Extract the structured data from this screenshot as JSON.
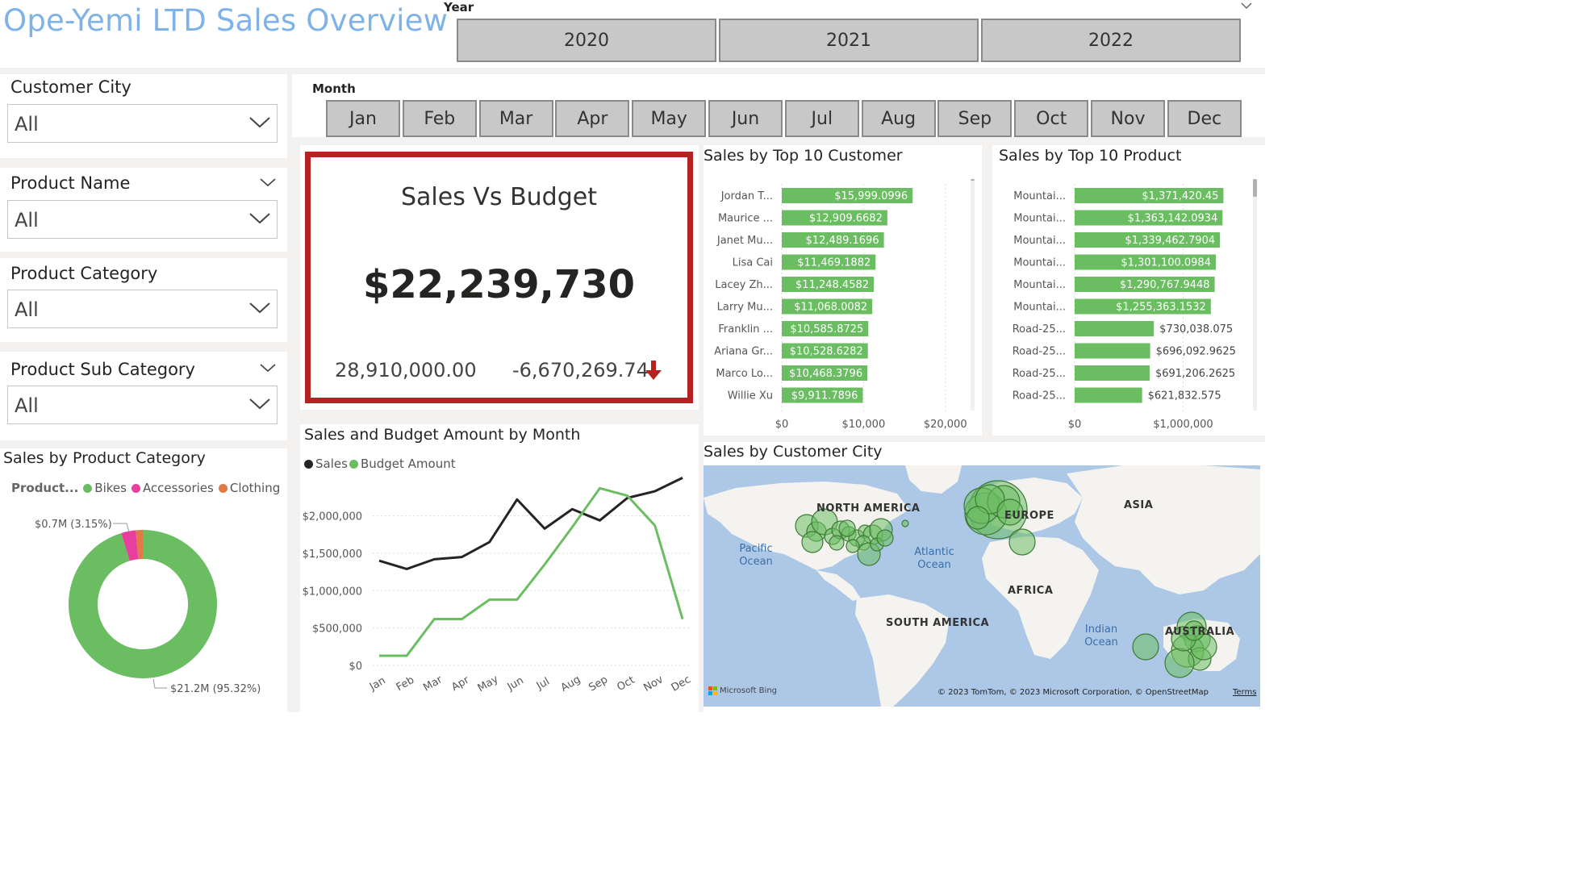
{
  "header": {
    "title": "Ope-Yemi LTD Sales Overview",
    "year_label": "Year",
    "years": [
      "2020",
      "2021",
      "2022"
    ]
  },
  "slicers": {
    "customer_city": {
      "title": "Customer City",
      "value": "All"
    },
    "product_name": {
      "title": "Product Name",
      "value": "All"
    },
    "product_category": {
      "title": "Product Category",
      "value": "All"
    },
    "product_sub_category": {
      "title": "Product Sub Category",
      "value": "All"
    }
  },
  "month": {
    "label": "Month",
    "months": [
      "Jan",
      "Feb",
      "Mar",
      "Apr",
      "May",
      "Jun",
      "Jul",
      "Aug",
      "Sep",
      "Oct",
      "Nov",
      "Dec"
    ]
  },
  "kpi": {
    "title": "Sales Vs Budget",
    "value": "$22,239,730",
    "goal": "28,910,000.00",
    "difference": "-6,670,269.74",
    "status_color": "#b52222"
  },
  "colors": {
    "bar_green": "#6bbd62",
    "sales_line": "#252423",
    "budget_line": "#6bbd62",
    "bikes": "#6bbd62",
    "accessories": "#e83e9d",
    "clothing": "#e07a46",
    "kpi_border": "#b52222"
  },
  "chart_data": [
    {
      "type": "bar",
      "id": "top-customers",
      "title": "Sales by Top 10 Customer",
      "orientation": "horizontal",
      "categories": [
        "Jordan T...",
        "Maurice ...",
        "Janet Mu...",
        "Lisa Cai",
        "Lacey Zh...",
        "Larry Mu...",
        "Franklin ...",
        "Ariana Gr...",
        "Marco Lo...",
        "Willie Xu"
      ],
      "values": [
        15999.0996,
        12909.6682,
        12489.1696,
        11469.1882,
        11248.4582,
        11068.0082,
        10585.8725,
        10528.6282,
        10468.3796,
        9911.7896
      ],
      "labels": [
        "$15,999.0996",
        "$12,909.6682",
        "$12,489.1696",
        "$11,469.1882",
        "$11,248.4582",
        "$11,068.0082",
        "$10,585.8725",
        "$10,528.6282",
        "$10,468.3796",
        "$9,911.7896"
      ],
      "xlim": [
        0,
        22000
      ],
      "xticks": [
        0,
        10000,
        20000
      ],
      "xtick_labels": [
        "$0",
        "$10,000",
        "$20,000"
      ]
    },
    {
      "type": "bar",
      "id": "top-products",
      "title": "Sales by Top 10 Product",
      "orientation": "horizontal",
      "categories": [
        "Mountai...",
        "Mountai...",
        "Mountai...",
        "Mountai...",
        "Mountai...",
        "Mountai...",
        "Road-25...",
        "Road-25...",
        "Road-25...",
        "Road-25..."
      ],
      "values": [
        1371420.45,
        1363142.0934,
        1339462.7904,
        1301100.0984,
        1290767.9448,
        1255363.1532,
        730038.075,
        696092.9625,
        691206.2625,
        621832.575
      ],
      "labels": [
        "$1,371,420.45",
        "$1,363,142.0934",
        "$1,339,462.7904",
        "$1,301,100.0984",
        "$1,290,767.9448",
        "$1,255,363.1532",
        "$730,038.075",
        "$696,092.9625",
        "$691,206.2625",
        "$621,832.575"
      ],
      "xlim": [
        0,
        1450000
      ],
      "xticks": [
        0,
        1000000
      ],
      "xtick_labels": [
        "$0",
        "$1,000,000"
      ]
    },
    {
      "type": "line",
      "id": "sales-budget-month",
      "title": "Sales and Budget Amount by Month",
      "categories": [
        "Jan",
        "Feb",
        "Mar",
        "Apr",
        "May",
        "Jun",
        "Jul",
        "Aug",
        "Sep",
        "Oct",
        "Nov",
        "Dec"
      ],
      "series": [
        {
          "name": "Sales",
          "values": [
            1400000,
            1290000,
            1420000,
            1450000,
            1650000,
            2220000,
            1830000,
            2090000,
            1940000,
            2240000,
            2330000,
            2510000
          ]
        },
        {
          "name": "Budget Amount",
          "values": [
            130000,
            130000,
            620000,
            620000,
            880000,
            880000,
            1350000,
            1850000,
            2370000,
            2270000,
            1870000,
            620000
          ]
        }
      ],
      "ylim": [
        0,
        2600000
      ],
      "yticks": [
        0,
        500000,
        1000000,
        1500000,
        2000000
      ],
      "ytick_labels": [
        "$0",
        "$500,000",
        "$1,000,000",
        "$1,500,000",
        "$2,000,000"
      ]
    },
    {
      "type": "pie",
      "id": "product-category",
      "title": "Sales by Product Category",
      "legend_title": "Product...",
      "categories": [
        "Bikes",
        "Accessories",
        "Clothing"
      ],
      "values": [
        95.32,
        3.15,
        1.53
      ],
      "labels": [
        {
          "category": "Bikes",
          "text": "$21.2M (95.32%)"
        },
        {
          "category": "Accessories",
          "text": "$0.7M (3.15%)"
        }
      ],
      "donut": true
    }
  ],
  "visuals": {
    "top_customers_title": "Sales by Top 10 Customer",
    "top_products_title": "Sales by Top 10 Product",
    "month_chart_title": "Sales and Budget Amount by Month",
    "category_title": "Sales by Product Category",
    "map_title": "Sales by Customer City"
  },
  "legend_line": {
    "sales": "Sales",
    "budget": "Budget Amount"
  },
  "legend_pie": {
    "title": "Product...",
    "bikes": "Bikes",
    "accessories": "Accessories",
    "clothing": "Clothing"
  },
  "pie_labels": {
    "accessories": "$0.7M (3.15%)",
    "bikes": "$21.2M (95.32%)"
  },
  "map": {
    "labels": {
      "north_america": "NORTH AMERICA",
      "europe": "EUROPE",
      "asia": "ASIA",
      "africa": "AFRICA",
      "south_america": "SOUTH AMERICA",
      "australia": "AUSTRALIA",
      "pacific": "Pacific Ocean",
      "atlantic": "Atlantic Ocean",
      "indian": "Indian Ocean"
    },
    "logo": "Microsoft Bing",
    "copyright": "© 2023 TomTom, © 2023 Microsoft Corporation, © OpenStreetMap",
    "terms": "Terms",
    "water_color": "#adc8e6",
    "land_color": "#f4f3ef",
    "bubble_color": "#6bbd62"
  }
}
